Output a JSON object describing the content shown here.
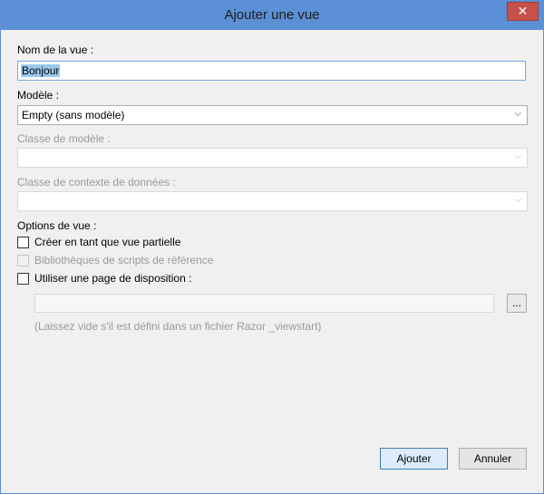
{
  "window": {
    "title": "Ajouter une vue",
    "close_glyph": "✕"
  },
  "fields": {
    "view_name_label": "Nom de la vue :",
    "view_name_value": "Bonjour",
    "template_label": "Modèle :",
    "template_value": "Empty (sans modèle)",
    "model_class_label": "Classe de modèle :",
    "data_context_label": "Classe de contexte de données :"
  },
  "options": {
    "heading": "Options de vue :",
    "partial_label": "Créer en tant que vue partielle",
    "scripts_label": "Bibliothèques de scripts de référence",
    "layout_label": "Utiliser une page de disposition :",
    "browse_label": "...",
    "hint": "(Laissez vide s'il est défini dans un fichier Razor _viewstart)"
  },
  "buttons": {
    "add": "Ajouter",
    "cancel": "Annuler"
  },
  "icons": {
    "dropdown": "chevron-down-icon",
    "close": "close-icon"
  },
  "colors": {
    "title_bar": "#5b8fd6",
    "close_button": "#c7504a",
    "selection": "#99c9ef"
  }
}
